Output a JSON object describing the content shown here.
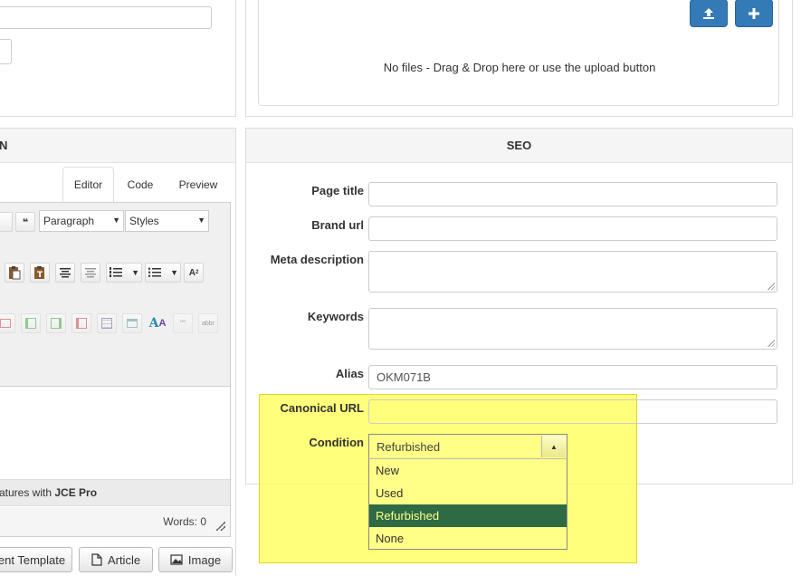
{
  "upload": {
    "empty_message": "No files - Drag & Drop here or use the upload button",
    "icons": [
      "upload-icon",
      "plus-icon"
    ]
  },
  "editor": {
    "section_title_partial": "N",
    "tabs": [
      {
        "label": "Editor",
        "active": true
      },
      {
        "label": "Code",
        "active": false
      },
      {
        "label": "Preview",
        "active": false
      }
    ],
    "format_select": "Paragraph",
    "styles_select": "Styles",
    "promo_text": "atures with ",
    "promo_brand": "JCE Pro",
    "words_label": "Words: 0",
    "bottom_buttons": [
      {
        "label": "ent Template",
        "icon": "template-icon"
      },
      {
        "label": "Article",
        "icon": "article-icon"
      },
      {
        "label": "Image",
        "icon": "image-icon"
      }
    ]
  },
  "seo": {
    "title": "SEO",
    "fields": {
      "page_title": {
        "label": "Page title",
        "value": ""
      },
      "brand_url": {
        "label": "Brand url",
        "value": ""
      },
      "meta_description": {
        "label": "Meta description",
        "value": ""
      },
      "keywords": {
        "label": "Keywords",
        "value": ""
      },
      "alias": {
        "label": "Alias",
        "value": "OKM071B"
      },
      "canonical_url": {
        "label": "Canonical URL",
        "value": ""
      },
      "condition": {
        "label": "Condition",
        "selected": "Refurbished",
        "options": [
          "New",
          "Used",
          "Refurbished",
          "None"
        ]
      }
    }
  },
  "colors": {
    "primary_button": "#337ab7",
    "highlight": "#ffff66",
    "selected_option": "#2e6b45"
  }
}
